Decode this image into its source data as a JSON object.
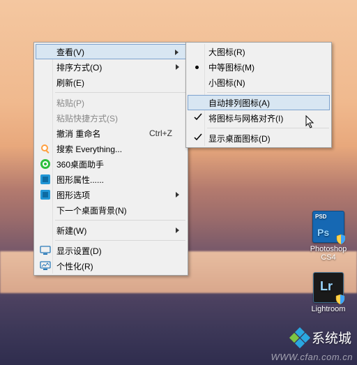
{
  "desktop": {
    "icons": [
      {
        "label": "Photoshop CS4",
        "kind": "psd"
      },
      {
        "label": "Lightroom",
        "kind": "lr"
      }
    ]
  },
  "contextMenu": {
    "items": [
      {
        "label": "查看(V)",
        "type": "submenu",
        "highlighted": true
      },
      {
        "label": "排序方式(O)",
        "type": "submenu"
      },
      {
        "label": "刷新(E)",
        "type": "item"
      },
      {
        "type": "sep"
      },
      {
        "label": "粘贴(P)",
        "type": "disabled"
      },
      {
        "label": "粘贴快捷方式(S)",
        "type": "disabled"
      },
      {
        "label": "撤消 重命名",
        "type": "item",
        "shortcut": "Ctrl+Z"
      },
      {
        "label": "搜索 Everything...",
        "type": "item",
        "icon": "search"
      },
      {
        "label": "360桌面助手",
        "type": "item",
        "icon": "360"
      },
      {
        "label": "图形属性......",
        "type": "item",
        "icon": "intel"
      },
      {
        "label": "图形选项",
        "type": "submenu",
        "icon": "intel"
      },
      {
        "label": "下一个桌面背景(N)",
        "type": "item"
      },
      {
        "type": "sep"
      },
      {
        "label": "新建(W)",
        "type": "submenu"
      },
      {
        "type": "sep"
      },
      {
        "label": "显示设置(D)",
        "type": "item",
        "icon": "display"
      },
      {
        "label": "个性化(R)",
        "type": "item",
        "icon": "personalize"
      }
    ]
  },
  "submenu": {
    "items": [
      {
        "label": "大图标(R)",
        "type": "radio",
        "checked": false
      },
      {
        "label": "中等图标(M)",
        "type": "radio",
        "checked": true
      },
      {
        "label": "小图标(N)",
        "type": "radio",
        "checked": false
      },
      {
        "type": "sep"
      },
      {
        "label": "自动排列图标(A)",
        "type": "check",
        "checked": false,
        "highlighted": true
      },
      {
        "label": "将图标与网格对齐(I)",
        "type": "check",
        "checked": true
      },
      {
        "type": "sep"
      },
      {
        "label": "显示桌面图标(D)",
        "type": "check",
        "checked": true
      }
    ]
  },
  "branding": {
    "logoText": "系统城",
    "watermark": "WWW.cfan.com.cn"
  }
}
